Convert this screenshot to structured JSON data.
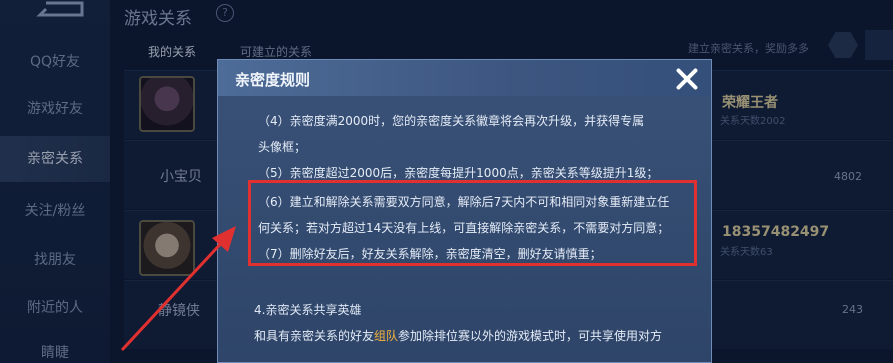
{
  "sidebar": {
    "items": [
      {
        "label": "QQ好友"
      },
      {
        "label": "游戏好友"
      },
      {
        "label": "亲密关系"
      },
      {
        "label": "关注/粉丝"
      },
      {
        "label": "找朋友"
      },
      {
        "label": "附近的人"
      },
      {
        "label": "睛睫"
      }
    ]
  },
  "header": {
    "title": "游戏关系",
    "help_glyph": "?",
    "tabs": [
      {
        "label": "我的关系"
      },
      {
        "label": "可建立的关系"
      }
    ],
    "search_placeholder": "建立亲密关系，奖励多多"
  },
  "list": {
    "rows": [
      {
        "name": "",
        "title": "荣耀王者",
        "subtitle": "关系天数2002",
        "gems": ""
      },
      {
        "name": "小宝贝",
        "title": "",
        "subtitle": "",
        "gems": "4802"
      },
      {
        "name": "",
        "title": "18357482497",
        "subtitle": "关系天数63",
        "gems": ""
      },
      {
        "name": "静镜侠",
        "title": "",
        "subtitle": "",
        "gems": "243"
      }
    ]
  },
  "modal": {
    "title": "亲密度规则",
    "lines": [
      "（4）亲密度满2000时，您的亲密度关系徽章将会再次升级，并获得专属",
      "头像框；",
      "（5）亲密度超过2000后，亲密度每提升1000点，亲密关系等级提升1级；",
      "（6）建立和解除关系需要双方同意，解除后7天内不可和相同对象重新建立任",
      "何关系；若对方超过14天没有上线，可直接解除亲密关系，不需要对方同意；",
      "（7）删除好友后，好友关系解除，亲密度清空，删好友请慎重；"
    ],
    "section_title": "4.亲密关系共享英雄",
    "last_line_pre": "和具有亲密关系的好友",
    "last_line_highlight": "组队",
    "last_line_post": "参加除排位赛以外的游戏模式时，可共享使用对方"
  },
  "colors": {
    "annotation": "#e03030",
    "highlight": "#f4b23a"
  }
}
